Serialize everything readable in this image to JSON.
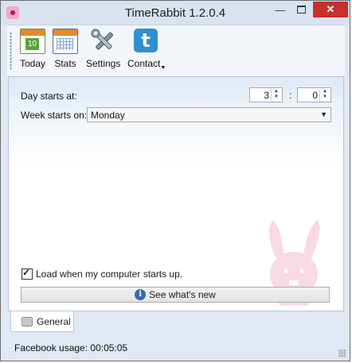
{
  "window": {
    "title": "TimeRabbit 1.2.0.4"
  },
  "toolbar": {
    "items": [
      {
        "label": "Today",
        "icon": "calendar-today-icon",
        "badge": "10"
      },
      {
        "label": "Stats",
        "icon": "calendar-stats-icon"
      },
      {
        "label": "Settings",
        "icon": "tools-icon"
      },
      {
        "label": "Contact",
        "icon": "twitter-icon"
      }
    ]
  },
  "settings": {
    "day_starts_label": "Day starts at:",
    "day_starts_hour": "3",
    "day_starts_separator": ":",
    "day_starts_minute": "0",
    "week_starts_label": "Week starts on:",
    "week_starts_value": "Monday",
    "load_on_startup_label": "Load when my computer starts up.",
    "load_on_startup_checked": true,
    "whats_new_label": "See what's new"
  },
  "tabs": [
    {
      "label": "General",
      "selected": true
    }
  ],
  "status": {
    "text": "Facebook usage: 00:05:05"
  },
  "colors": {
    "close_button": "#c7302b",
    "accent_blue": "#2f6db5",
    "twitter_blue": "#2f8fd0"
  }
}
